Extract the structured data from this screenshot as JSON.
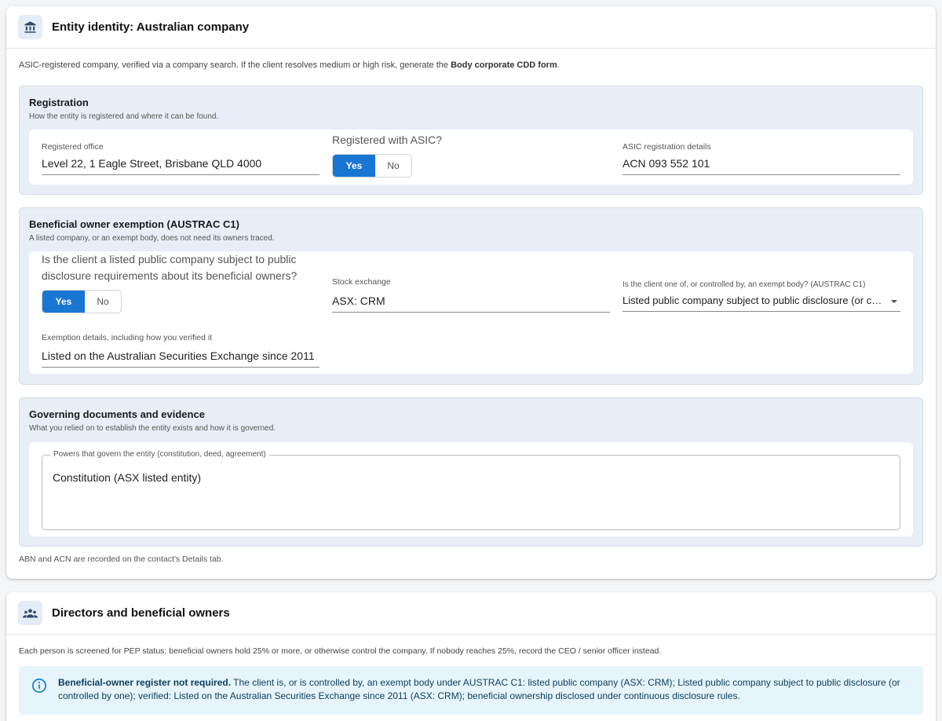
{
  "entity_card": {
    "title": "Entity identity: Australian company",
    "intro_prefix": "ASIC-registered company, verified via a company search. If the client resolves medium or high risk, generate the ",
    "intro_link": "Body corporate CDD form",
    "intro_suffix": ".",
    "registration": {
      "title": "Registration",
      "subtitle": "How the entity is registered and where it can be found.",
      "office_label": "Registered office",
      "office_value": "Level 22, 1 Eagle Street, Brisbane QLD 4000",
      "asic_question": "Registered with ASIC?",
      "yes_label": "Yes",
      "no_label": "No",
      "asic_selected": "Yes",
      "details_label": "ASIC registration details",
      "details_value": "ACN 093 552 101"
    },
    "exemption": {
      "title": "Beneficial owner exemption (AUSTRAC C1)",
      "subtitle": "A listed company, or an exempt body, does not need its owners traced.",
      "listed_question": "Is the client a listed public company subject to public disclosure requirements about its beneficial owners?",
      "yes_label": "Yes",
      "no_label": "No",
      "listed_selected": "Yes",
      "exchange_label": "Stock exchange",
      "exchange_value": "ASX: CRM",
      "exempt_body_label": "Is the client one of, or controlled by, an exempt body? (AUSTRAC C1)",
      "exempt_body_value": "Listed public company subject to public disclosure (or controlled by one)",
      "details_label": "Exemption details, including how you verified it",
      "details_value": "Listed on the Australian Securities Exchange since 2011"
    },
    "governing": {
      "title": "Governing documents and evidence",
      "subtitle": "What you relied on to establish the entity exists and how it is governed.",
      "powers_label": "Powers that govern the entity (constitution, deed, agreement)",
      "powers_value": "Constitution (ASX listed entity)"
    },
    "footnote": "ABN and ACN are recorded on the contact's Details tab."
  },
  "directors_card": {
    "title": "Directors and beneficial owners",
    "intro": "Each person is screened for PEP status; beneficial owners hold 25% or more, or otherwise control the company. If nobody reaches 25%, record the CEO / senior officer instead.",
    "alert_title": "Beneficial-owner register not required.",
    "alert_body": " The client is, or is controlled by, an exempt body under AUSTRAC C1: listed public company (ASX: CRM); Listed public company subject to public disclosure (or controlled by one); verified: Listed on the Australian Securities Exchange since 2011 (ASX: CRM); beneficial ownership disclosed under continuous disclosure rules."
  },
  "icons": {
    "entity": "bank-building-icon",
    "directors": "people-group-icon",
    "alert": "info-icon",
    "dropdown": "chevron-down-icon"
  },
  "colors": {
    "primary": "#1976d2",
    "panel_bg": "#e8eef7",
    "alert_bg": "#e6f4fb",
    "alert_text": "#0b3d5c"
  }
}
